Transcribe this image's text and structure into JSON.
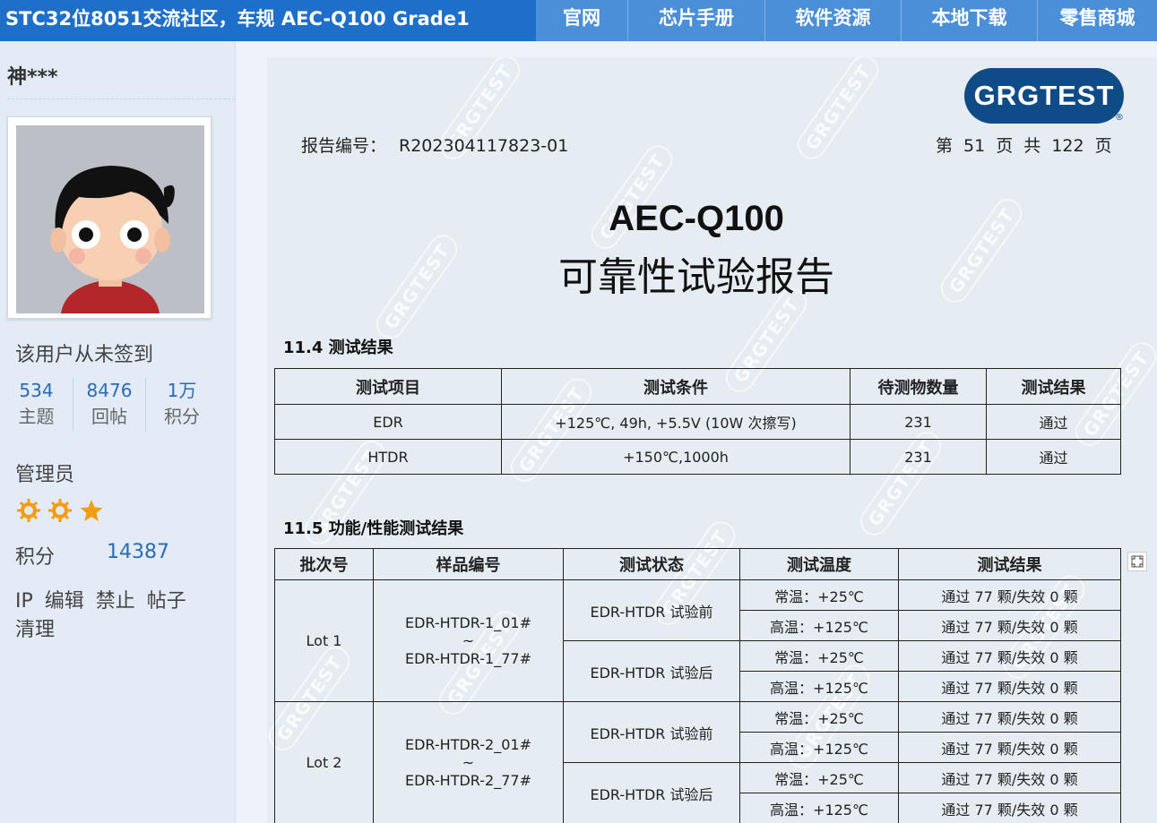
{
  "header": {
    "title": "STC32位8051交流社区，车规 AEC-Q100 Grade1",
    "nav": [
      "官网",
      "芯片手册",
      "软件资源",
      "本地下载",
      "零售商城"
    ]
  },
  "sidebar": {
    "username": "神***",
    "checkin_status": "该用户从未签到",
    "stats": [
      {
        "value": "534",
        "label": "主题"
      },
      {
        "value": "8476",
        "label": "回帖"
      },
      {
        "value": "1万",
        "label": "积分"
      }
    ],
    "role": "管理员",
    "points_label": "积分",
    "points_value": "14387",
    "admin_links": [
      "IP",
      "编辑",
      "禁止",
      "帖子",
      "清理"
    ]
  },
  "document": {
    "logo_text": "GRGTEST",
    "logo_registered": "®",
    "report_no_label": "报告编号：",
    "report_no": "R202304117823-01",
    "page_info": "第 51 页 共 122 页",
    "title_line1": "AEC-Q100",
    "title_line2": "可靠性试验报告",
    "watermark": "GRGTEST",
    "section1": "11.4  测试结果",
    "table1": {
      "headers": [
        "测试项目",
        "测试条件",
        "待测物数量",
        "测试结果"
      ],
      "rows": [
        [
          "EDR",
          "+125℃, 49h, +5.5V (10W 次擦写)",
          "231",
          "通过"
        ],
        [
          "HTDR",
          "+150℃,1000h",
          "231",
          "通过"
        ]
      ]
    },
    "section2": "11.5 功能/性能测试结果",
    "table2": {
      "headers": [
        "批次号",
        "样品编号",
        "测试状态",
        "测试温度",
        "测试结果"
      ],
      "lots": [
        {
          "lot": "Lot 1",
          "sample_line1": "EDR-HTDR-1_01#",
          "sample_line2": "~",
          "sample_line3": "EDR-HTDR-1_77#",
          "states": [
            {
              "state": "EDR-HTDR 试验前",
              "rows": [
                {
                  "temp": "常温：+25℃",
                  "result": "通过 77 颗/失效 0 颗"
                },
                {
                  "temp": "高温：+125℃",
                  "result": "通过 77 颗/失效 0 颗"
                }
              ]
            },
            {
              "state": "EDR-HTDR 试验后",
              "rows": [
                {
                  "temp": "常温：+25℃",
                  "result": "通过 77 颗/失效 0 颗"
                },
                {
                  "temp": "高温：+125℃",
                  "result": "通过 77 颗/失效 0 颗"
                }
              ]
            }
          ]
        },
        {
          "lot": "Lot 2",
          "sample_line1": "EDR-HTDR-2_01#",
          "sample_line2": "~",
          "sample_line3": "EDR-HTDR-2_77#",
          "states": [
            {
              "state": "EDR-HTDR 试验前",
              "rows": [
                {
                  "temp": "常温：+25℃",
                  "result": "通过 77 颗/失效 0 颗"
                },
                {
                  "temp": "高温：+125℃",
                  "result": "通过 77 颗/失效 0 颗"
                }
              ]
            },
            {
              "state": "EDR-HTDR 试验后",
              "rows": [
                {
                  "temp": "常温：+25℃",
                  "result": "通过 77 颗/失效 0 颗"
                },
                {
                  "temp": "高温：+125℃",
                  "result": "通过 77 颗/失效 0 颗"
                }
              ]
            }
          ]
        }
      ]
    }
  },
  "colors": {
    "header_dark": "#1e6fc9",
    "header_light": "#4a8fd8",
    "link_blue": "#2a6bb5",
    "star_orange": "#f39c12",
    "logo_navy": "#0f4c87"
  }
}
